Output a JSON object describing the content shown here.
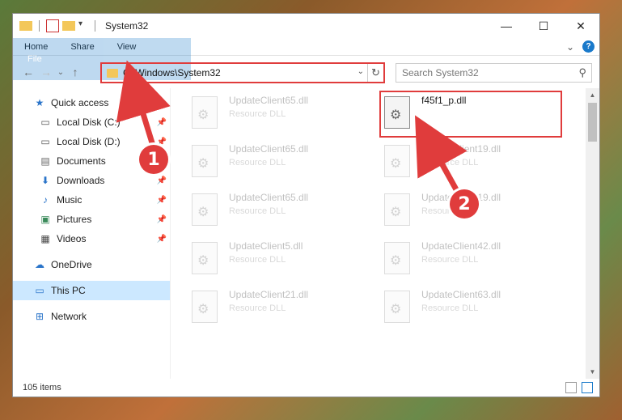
{
  "titlebar": {
    "title": "System32",
    "minimize": "—",
    "maximize": "☐",
    "close": "✕"
  },
  "ribbon": {
    "tabs": [
      "File",
      "Home",
      "Share",
      "View"
    ],
    "expand": "⌄",
    "help": "?"
  },
  "nav": {
    "back": "←",
    "forward": "→",
    "recent": "⌄",
    "up": "↑",
    "address": "C:\\Windows\\System32",
    "search_placeholder": "Search System32"
  },
  "sidebar": {
    "items": [
      {
        "label": "Quick access",
        "icon": "star-icon"
      },
      {
        "label": "Local Disk (C:)",
        "icon": "drive-icon",
        "pinned": true
      },
      {
        "label": "Local Disk (D:)",
        "icon": "drive-icon",
        "pinned": true
      },
      {
        "label": "Documents",
        "icon": "documents-icon",
        "pinned": true
      },
      {
        "label": "Downloads",
        "icon": "download-icon",
        "pinned": true
      },
      {
        "label": "Music",
        "icon": "music-icon",
        "pinned": true
      },
      {
        "label": "Pictures",
        "icon": "pictures-icon",
        "pinned": true
      },
      {
        "label": "Videos",
        "icon": "videos-icon",
        "pinned": true
      },
      {
        "label": "OneDrive",
        "icon": "cloud-icon"
      },
      {
        "label": "This PC",
        "icon": "computer-icon",
        "selected": true
      },
      {
        "label": "Network",
        "icon": "network-icon"
      }
    ]
  },
  "files": [
    {
      "name": "UpdateClient65.dll",
      "type": "Resource DLL"
    },
    {
      "name": "f45f1_p.dll",
      "type": "",
      "highlighted": true
    },
    {
      "name": "UpdateClient65.dll",
      "type": "Resource DLL"
    },
    {
      "name": "UpdateClient19.dll",
      "type": "Resource DLL"
    },
    {
      "name": "UpdateClient65.dll",
      "type": "Resource DLL"
    },
    {
      "name": "UpdateClient19.dll",
      "type": "Resource DLL"
    },
    {
      "name": "UpdateClient5.dll",
      "type": "Resource DLL"
    },
    {
      "name": "UpdateClient42.dll",
      "type": "Resource DLL"
    },
    {
      "name": "UpdateClient21.dll",
      "type": "Resource DLL"
    },
    {
      "name": "UpdateClient63.dll",
      "type": "Resource DLL"
    }
  ],
  "status": {
    "item_count": "105 items"
  },
  "callouts": {
    "one": "1",
    "two": "2"
  },
  "colors": {
    "accent": "#1979ca",
    "highlight_red": "#e03c3c",
    "selected_bg": "#cce8ff"
  }
}
